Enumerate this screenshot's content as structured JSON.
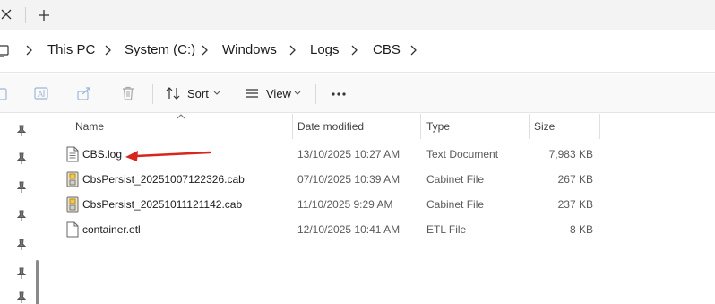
{
  "tabs": {
    "close_icon": "close-icon",
    "new_tab_icon": "plus-icon"
  },
  "breadcrumb": {
    "items": [
      "This PC",
      "System (C:)",
      "Windows",
      "Logs",
      "CBS"
    ]
  },
  "toolbar": {
    "sort_label": "Sort",
    "view_label": "View"
  },
  "columns": {
    "name": "Name",
    "date": "Date modified",
    "type": "Type",
    "size": "Size"
  },
  "files": [
    {
      "name": "CBS.log",
      "date": "13/10/2025 10:27 AM",
      "type": "Text Document",
      "size": "7,983 KB",
      "icon": "text-file-icon"
    },
    {
      "name": "CbsPersist_20251007122326.cab",
      "date": "07/10/2025 10:39 AM",
      "type": "Cabinet File",
      "size": "267 KB",
      "icon": "cabinet-file-icon"
    },
    {
      "name": "CbsPersist_20251011121142.cab",
      "date": "11/10/2025 9:29 AM",
      "type": "Cabinet File",
      "size": "237 KB",
      "icon": "cabinet-file-icon"
    },
    {
      "name": "container.etl",
      "date": "12/10/2025 10:41 AM",
      "type": "ETL File",
      "size": "8 KB",
      "icon": "blank-file-icon"
    }
  ],
  "colors": {
    "annotation_arrow": "#d9261c",
    "accent": "#0067c0"
  }
}
